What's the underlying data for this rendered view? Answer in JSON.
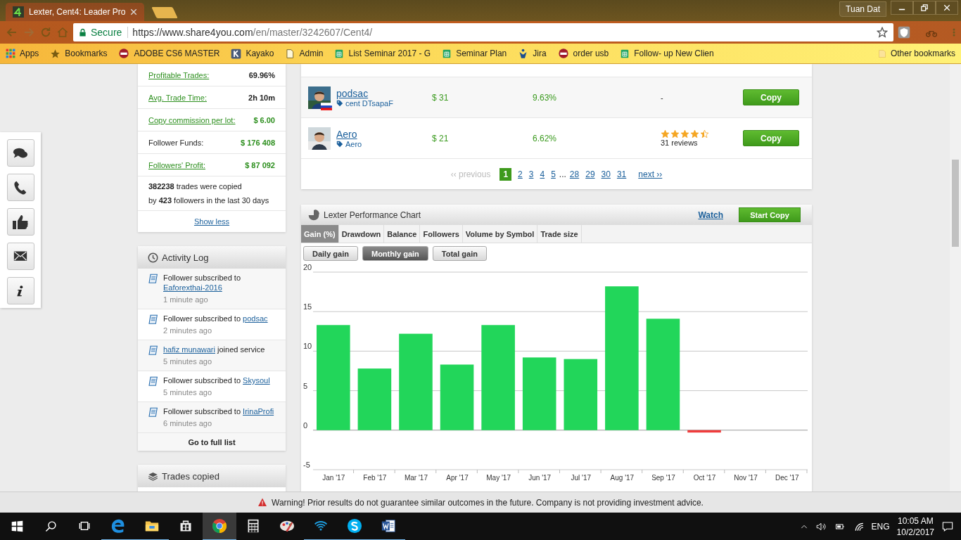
{
  "browser": {
    "tab_title": "Lexter, Cent4: Leader Pro",
    "user": "Tuan Dat",
    "security": "Secure",
    "url_host": "https://www.share4you.com",
    "url_path": "/en/master/3242607/Cent4/",
    "bookmarks": [
      {
        "label": "Apps",
        "kind": "apps"
      },
      {
        "label": "Bookmarks",
        "kind": "star"
      },
      {
        "label": "ADOBE CS6 MASTER",
        "kind": "badge"
      },
      {
        "label": "Kayako",
        "kind": "k"
      },
      {
        "label": "Admin",
        "kind": "page"
      },
      {
        "label": "List Seminar 2017 - G",
        "kind": "sheet"
      },
      {
        "label": "Seminar Plan",
        "kind": "sheet"
      },
      {
        "label": "Jira",
        "kind": "jira"
      },
      {
        "label": "order usb",
        "kind": "badge"
      },
      {
        "label": "Follow- up New Clien",
        "kind": "sheet"
      }
    ],
    "other_bookmarks": "Other bookmarks"
  },
  "side_buttons": [
    {
      "kind": "chat"
    },
    {
      "kind": "phone"
    },
    {
      "kind": "like"
    },
    {
      "kind": "mail"
    },
    {
      "kind": "info"
    }
  ],
  "stats": {
    "rows": [
      {
        "label": "Profitable Trades:",
        "kind": "link",
        "value": "69.96%",
        "highlight": false
      },
      {
        "label": "Avg. Trade Time:",
        "kind": "link",
        "value": "2h 10m",
        "highlight": false
      },
      {
        "label": "Copy commission per lot:",
        "kind": "link",
        "value": "$ 6.00",
        "highlight": true
      },
      {
        "label": "Follower Funds:",
        "kind": "text",
        "value": "$ 176 408",
        "highlight": true
      },
      {
        "label": "Followers' Profit:",
        "kind": "link",
        "value": "$ 87 092",
        "highlight": true
      }
    ],
    "summary": [
      "**382238** trades were copied",
      "by **423** followers in the last 30 days"
    ],
    "show_less": "Show less"
  },
  "activity_log": {
    "title": "Activity Log",
    "entries": [
      {
        "before": "Follower subscribed to ",
        "link": "Eaforexthai-2016",
        "time": "1 minute ago"
      },
      {
        "before": "Follower subscribed to ",
        "link": "podsac",
        "time": "2 minutes ago"
      },
      {
        "link": "hafiz munawari",
        "after": " joined service",
        "time": "5 minutes ago"
      },
      {
        "before": "Follower subscribed to ",
        "link": "Skysoul",
        "time": "5 minutes ago"
      },
      {
        "before": "Follower subscribed to ",
        "link": "IrinaProfi",
        "time": "6 minutes ago"
      }
    ],
    "footer": "Go to full list"
  },
  "trades_copied": {
    "title": "Trades copied"
  },
  "leaders": [
    {
      "name": "podsac",
      "tag": "cent DTsapaF",
      "flag": true,
      "funds": "$ 31",
      "gain": "9.63%",
      "kind": "unrated",
      "rating": "-",
      "button": "Copy"
    },
    {
      "name": "Aero",
      "tag": "Aero",
      "flag": false,
      "funds": "$ 21",
      "gain": "6.62%",
      "kind": "rated",
      "stars": 4.5,
      "reviews": "31 reviews",
      "button": "Copy"
    }
  ],
  "pagination": {
    "previous": "‹‹ previous",
    "next": "next ››",
    "pages": [
      {
        "label": "1",
        "kind": "page",
        "selected": true
      },
      {
        "label": "2",
        "kind": "page",
        "selected": false
      },
      {
        "label": "3",
        "kind": "page",
        "selected": false
      },
      {
        "label": "4",
        "kind": "page",
        "selected": false
      },
      {
        "label": "5",
        "kind": "page",
        "selected": false
      },
      {
        "label": "...",
        "kind": "ellipsis"
      },
      {
        "label": "28",
        "kind": "page",
        "selected": false
      },
      {
        "label": "29",
        "kind": "page",
        "selected": false
      },
      {
        "label": "30",
        "kind": "page",
        "selected": false
      },
      {
        "label": "31",
        "kind": "page",
        "selected": false
      }
    ]
  },
  "performance": {
    "title": "Lexter Performance Chart",
    "watch": "Watch",
    "start_copy": "Start Copy",
    "tabs": [
      {
        "label": "Gain (%)",
        "selected": true
      },
      {
        "label": "Drawdown",
        "selected": false
      },
      {
        "label": "Balance",
        "selected": false
      },
      {
        "label": "Followers",
        "selected": false
      },
      {
        "label": "Volume by Symbol",
        "selected": false
      },
      {
        "label": "Trade size",
        "selected": false
      }
    ],
    "modes": [
      {
        "label": "Daily gain",
        "selected": false
      },
      {
        "label": "Monthly gain",
        "selected": true
      },
      {
        "label": "Total gain",
        "selected": false
      }
    ],
    "chart_data": {
      "type": "bar",
      "categories": [
        "Jan '17",
        "Feb '17",
        "Mar '17",
        "Apr '17",
        "May '17",
        "Jun '17",
        "Jul '17",
        "Aug '17",
        "Sep '17",
        "Oct '17",
        "Nov '17",
        "Dec '17"
      ],
      "series": [
        {
          "color": "#22d65a",
          "values": [
            13.3,
            7.8,
            12.2,
            8.3,
            13.3,
            9.2,
            9.0,
            18.2,
            14.1,
            null,
            null,
            null
          ]
        },
        {
          "color": "#f03c3c",
          "values": [
            null,
            null,
            null,
            null,
            null,
            null,
            null,
            null,
            null,
            -0.3,
            null,
            null
          ]
        }
      ],
      "ylim": [
        -5,
        20
      ],
      "yticks": [
        -5,
        0,
        5,
        10,
        15,
        20
      ],
      "grid": true
    }
  },
  "warning": "Warning! Prior results do not guarantee similar outcomes in the future. Company is not providing investment advice.",
  "taskbar": {
    "apps": [
      {
        "kind": "edge",
        "running": true,
        "selected": false
      },
      {
        "kind": "folder",
        "running": true,
        "selected": false
      },
      {
        "kind": "store",
        "running": false,
        "selected": false
      },
      {
        "kind": "chrome",
        "running": true,
        "selected": true
      },
      {
        "kind": "calculator",
        "running": false,
        "selected": false
      },
      {
        "kind": "paint",
        "running": false,
        "selected": false
      },
      {
        "kind": "wifi",
        "running": true,
        "selected": false
      },
      {
        "kind": "skype",
        "running": true,
        "selected": false
      },
      {
        "kind": "word",
        "running": true,
        "selected": false
      }
    ],
    "language": "ENG",
    "time": "10:05 AM",
    "date": "10/2/2017"
  }
}
